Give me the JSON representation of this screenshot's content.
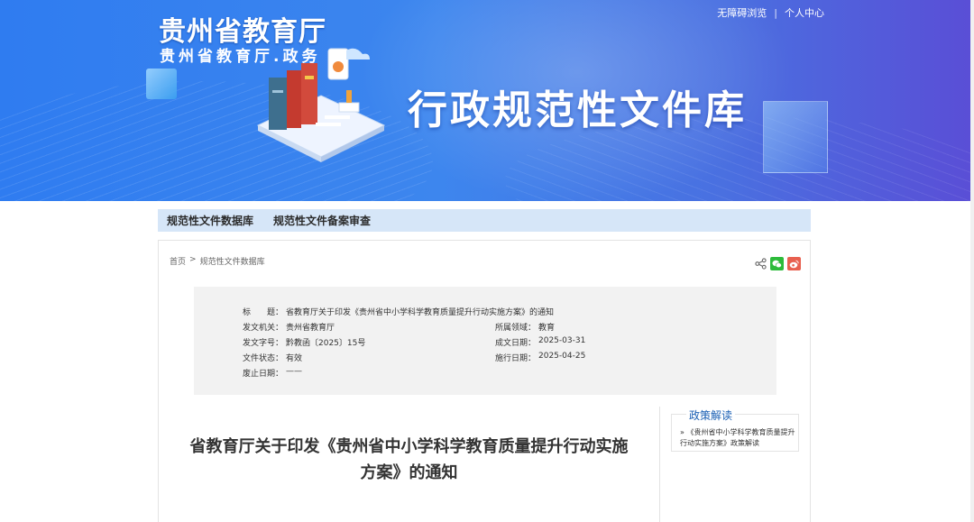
{
  "header": {
    "org_title": "贵州省教育厅",
    "org_subtitle": "贵州省教育厅.政务",
    "banner_title": "行政规范性文件库",
    "top_links": [
      {
        "label": "无障碍浏览"
      },
      {
        "label": "个人中心"
      }
    ],
    "separator": "|"
  },
  "nav": {
    "items": [
      {
        "label": "规范性文件数据库"
      },
      {
        "label": "规范性文件备案审查"
      }
    ]
  },
  "breadcrumb": {
    "home": "首页",
    "sep": ">",
    "current": "规范性文件数据库"
  },
  "share": {
    "icons": [
      "share-icon",
      "wechat-icon",
      "weibo-icon"
    ]
  },
  "meta": {
    "title_label": "标　　题：",
    "title_value": "省教育厅关于印发《贵州省中小学科学教育质量提升行动实施方案》的通知",
    "issuer_label": "发文机关：",
    "issuer_value": "贵州省教育厅",
    "domain_label": "所属领域：",
    "domain_value": "教育",
    "doc_no_label": "发文字号：",
    "doc_no_value": "黔教函〔2025〕15号",
    "date_label": "成文日期：",
    "date_value": "2025-03-31",
    "status_label": "文件状态：",
    "status_value": "有效",
    "effective_label": "施行日期：",
    "effective_value": "2025-04-25",
    "abolish_label": "废止日期：",
    "abolish_value": "——"
  },
  "document": {
    "title": "省教育厅关于印发《贵州省中小学科学教育质量提升行动实施方案》的通知"
  },
  "policy": {
    "heading": "政策解读",
    "bullet": "»",
    "link": "《贵州省中小学科学教育质量提升行动实施方案》政策解读"
  },
  "colors": {
    "banner_start": "#2f7cf0",
    "banner_end": "#5a4ed6",
    "nav_bg": "#d6e6f8",
    "policy_heading": "#1a5fb4"
  }
}
